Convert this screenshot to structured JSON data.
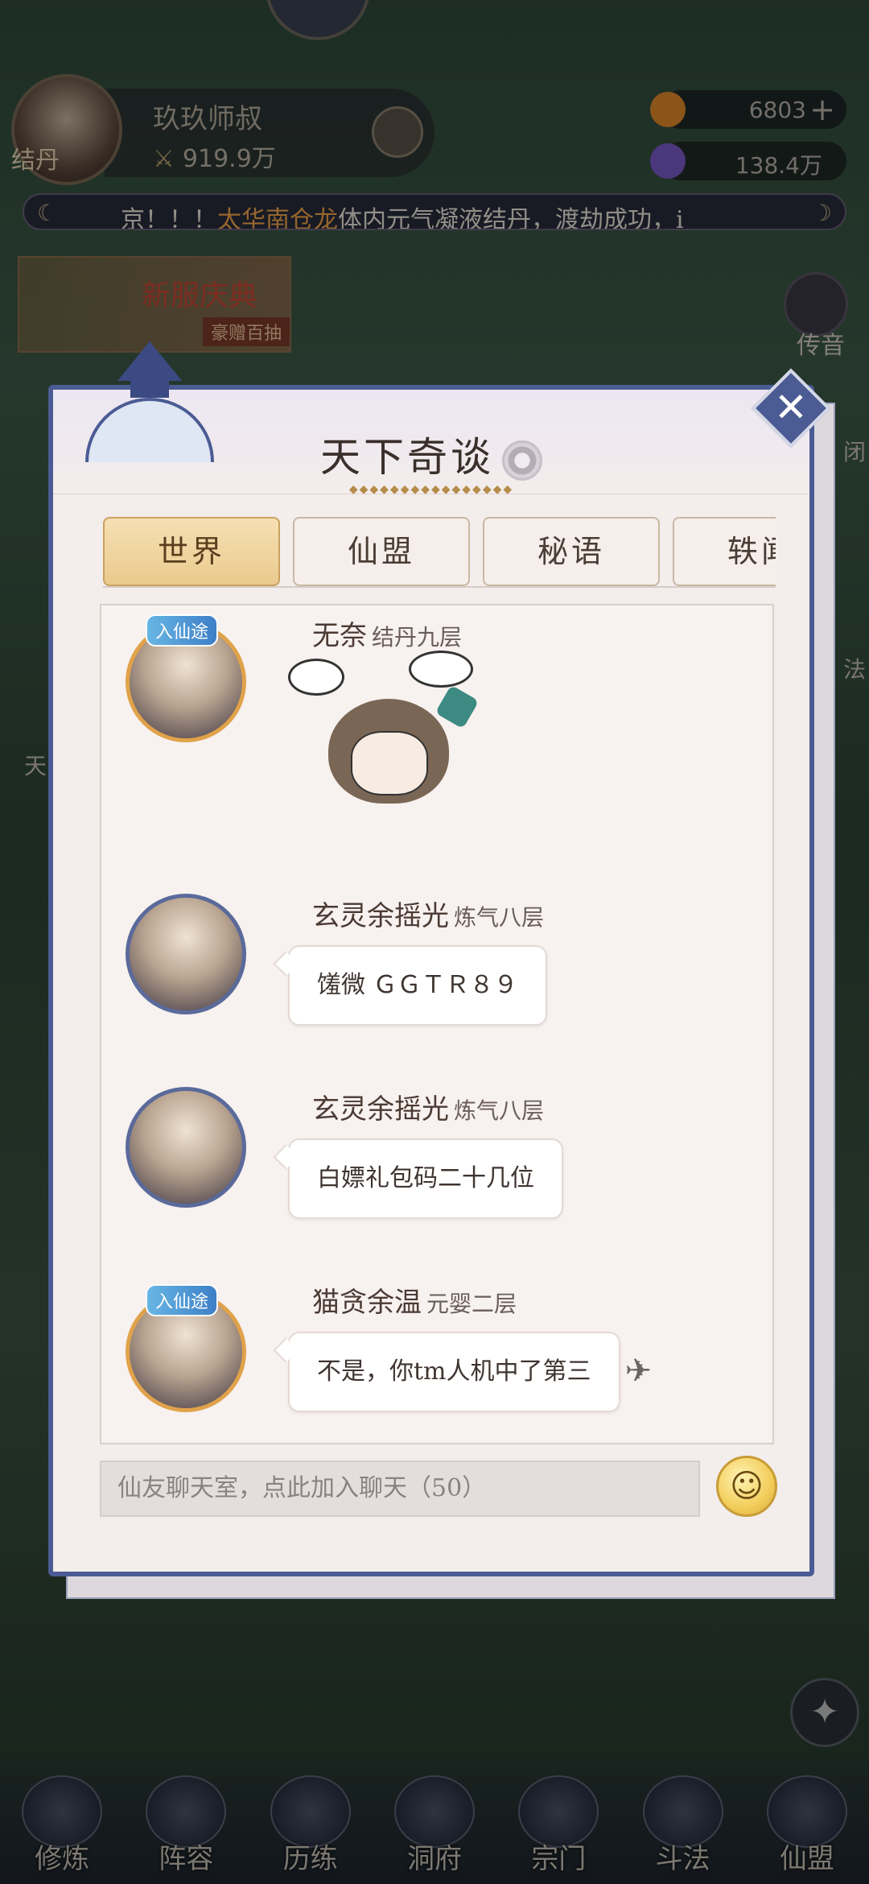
{
  "player": {
    "avatar_tag": "结丹",
    "name": "玖玖师叔",
    "power": "919.9万"
  },
  "currency": [
    {
      "value": "6803",
      "icon": "jade-coin-icon",
      "color": "#e08a2a"
    },
    {
      "value": "138.4万",
      "icon": "spirit-stone-icon",
      "color": "#7a5ac9"
    }
  ],
  "ticker": {
    "prefix": "京！！！",
    "highlight": "太华南仓龙",
    "suffix": "体内元气凝液结丹，渡劫成功，i"
  },
  "event_banner": {
    "title": "新服庆典",
    "subtitle": "豪赠百抽"
  },
  "mail": {
    "label": "传音"
  },
  "side_peek": [
    "闭",
    "法",
    "天"
  ],
  "chat": {
    "title": "天下奇谈",
    "tabs": [
      {
        "label": "世界",
        "active": true
      },
      {
        "label": "仙盟",
        "active": false
      },
      {
        "label": "秘语",
        "active": false
      },
      {
        "label": "轶闻",
        "active": false
      }
    ],
    "messages": [
      {
        "name": "无奈",
        "rank": "结丹九层",
        "badge": "入仙途",
        "type": "sticker"
      },
      {
        "name": "玄灵余摇光",
        "rank": "炼气八层",
        "text": "馐微 ＧＧＴＲ８９"
      },
      {
        "name": "玄灵余摇光",
        "rank": "炼气八层",
        "text": "白嫖礼包码二十几位"
      },
      {
        "name": "猫贪余温",
        "rank": "元婴二层",
        "badge": "入仙途",
        "text": "不是，你tm人机中了第三"
      }
    ],
    "input_placeholder": "仙友聊天室，点此加入聊天（50）"
  },
  "bottom_nav": [
    {
      "label": "修炼",
      "icon": "cultivate-icon"
    },
    {
      "label": "阵容",
      "icon": "lineup-icon"
    },
    {
      "label": "历练",
      "icon": "adventure-icon"
    },
    {
      "label": "洞府",
      "icon": "cave-icon"
    },
    {
      "label": "宗门",
      "icon": "sect-icon"
    },
    {
      "label": "斗法",
      "icon": "duel-icon"
    },
    {
      "label": "仙盟",
      "icon": "alliance-icon"
    }
  ]
}
